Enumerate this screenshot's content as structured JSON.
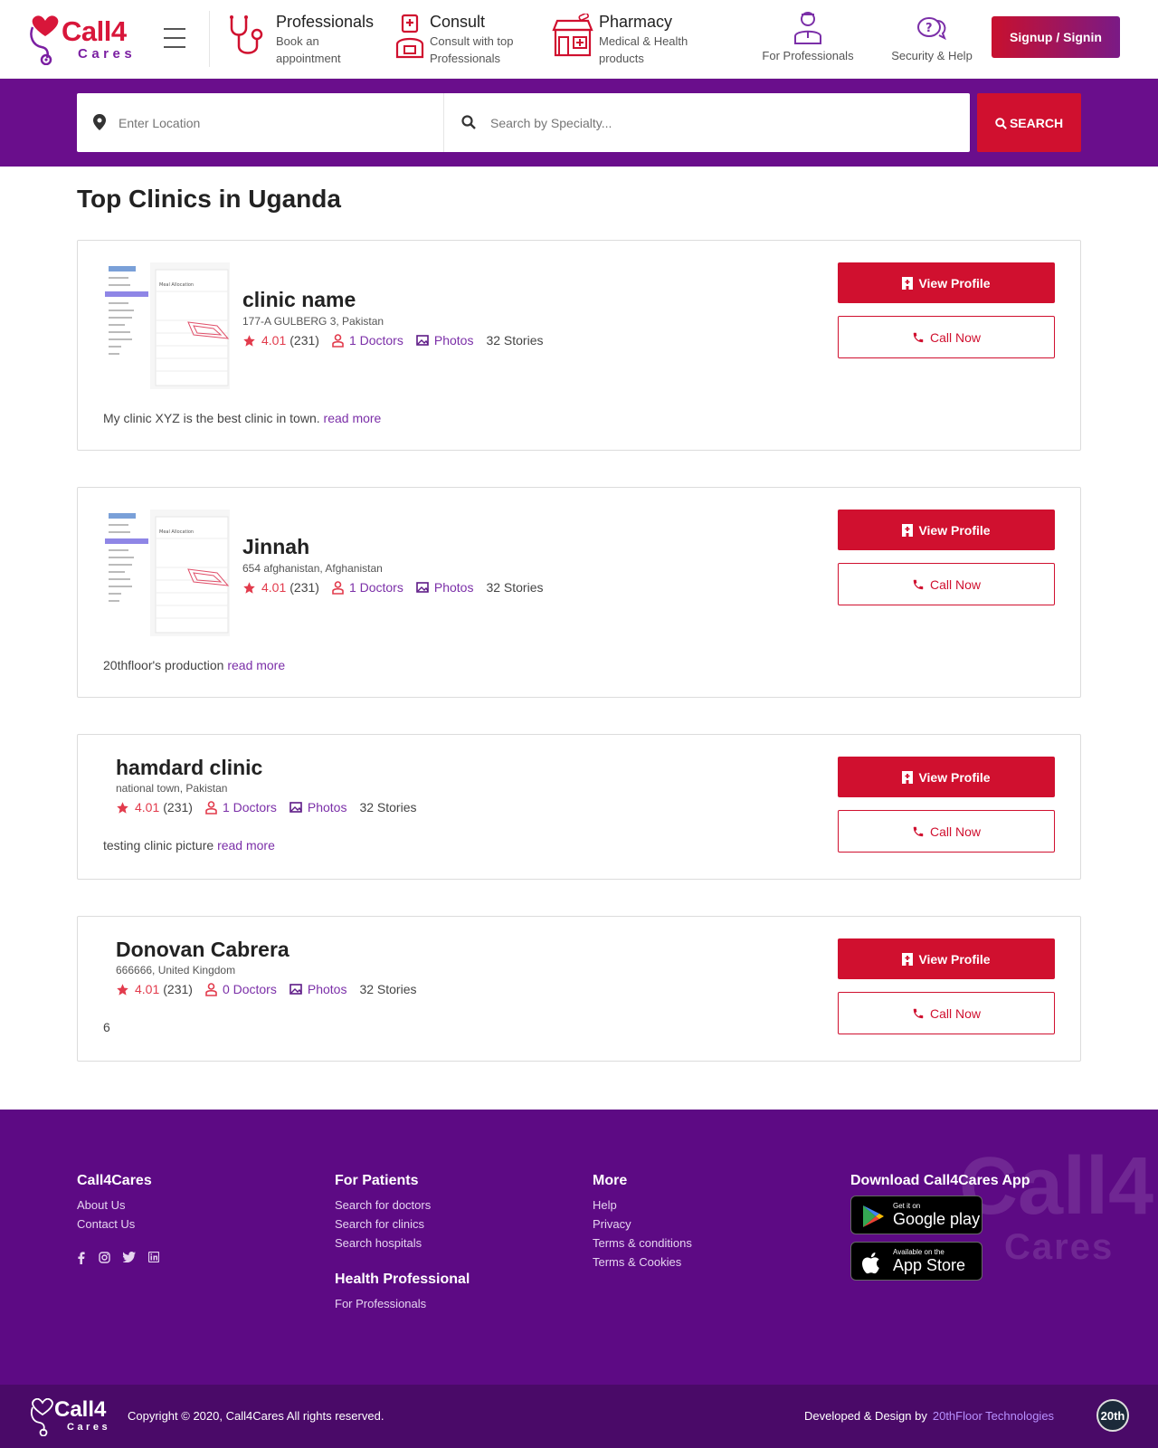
{
  "brand": {
    "name": "Call4",
    "sub": "Cares"
  },
  "nav": [
    {
      "title": "Professionals",
      "sub": "Book an appointment"
    },
    {
      "title": "Consult",
      "sub": "Consult with top Professionals"
    },
    {
      "title": "Pharmacy",
      "sub": "Medical & Health products"
    }
  ],
  "nav_right": [
    {
      "label": "For Professionals"
    },
    {
      "label": "Security & Help"
    }
  ],
  "signup_label": "Signup / Signin",
  "search": {
    "location_placeholder": "Enter Location",
    "specialty_placeholder": "Search by Specialty...",
    "button_label": "SEARCH"
  },
  "page_title": "Top Clinics in Uganda",
  "clinics": [
    {
      "name": "clinic name",
      "address": "177-A GULBERG 3, Pakistan",
      "rating": "4.01",
      "reviews": "(231)",
      "doctors": "1 Doctors",
      "photos": "Photos",
      "stories": "32 Stories",
      "description": "My clinic XYZ is the best clinic in town.",
      "read_more": "read more",
      "view_label": "View Profile",
      "call_label": "Call Now"
    },
    {
      "name": "Jinnah",
      "address": "654 afghanistan, Afghanistan",
      "rating": "4.01",
      "reviews": "(231)",
      "doctors": "1 Doctors",
      "photos": "Photos",
      "stories": "32 Stories",
      "description": "20thfloor's production",
      "read_more": "read more",
      "view_label": "View Profile",
      "call_label": "Call Now"
    },
    {
      "name": "hamdard clinic",
      "address": "national town, Pakistan",
      "rating": "4.01",
      "reviews": "(231)",
      "doctors": "1 Doctors",
      "photos": "Photos",
      "stories": "32 Stories",
      "description": "testing clinic picture",
      "read_more": "read more",
      "view_label": "View Profile",
      "call_label": "Call Now"
    },
    {
      "name": "Donovan Cabrera",
      "address": "666666, United Kingdom",
      "rating": "4.01",
      "reviews": "(231)",
      "doctors": "0 Doctors",
      "photos": "Photos",
      "stories": "32 Stories",
      "description": "6",
      "read_more": "",
      "view_label": "View Profile",
      "call_label": "Call Now"
    }
  ],
  "footer": {
    "col1": {
      "title": "Call4Cares",
      "links": [
        "About Us",
        "Contact Us"
      ]
    },
    "col2": {
      "title": "For Patients",
      "links": [
        "Search for doctors",
        "Search for clinics",
        "Search hospitals"
      ],
      "title2": "Health Professional",
      "links2": [
        "For Professionals"
      ]
    },
    "col3": {
      "title": "More",
      "links": [
        "Help",
        "Privacy",
        "Terms & conditions",
        "Terms & Cookies"
      ]
    },
    "col4": {
      "title": "Download Call4Cares App"
    },
    "google": {
      "small": "Get it on",
      "big": "Google play"
    },
    "apple": {
      "small": "Available on the",
      "big": "App Store"
    },
    "watermark": "Call4",
    "watermark_sub": "Cares"
  },
  "bottom": {
    "copyright": "Copyright © 2020, Call4Cares All rights reserved.",
    "developed": "Developed & Design by",
    "company": "20thFloor Technologies",
    "badge": "20th"
  },
  "colors": {
    "primary_red": "#d0102f",
    "purple": "#6a0e8c",
    "footer_purple": "#5d0a84"
  }
}
